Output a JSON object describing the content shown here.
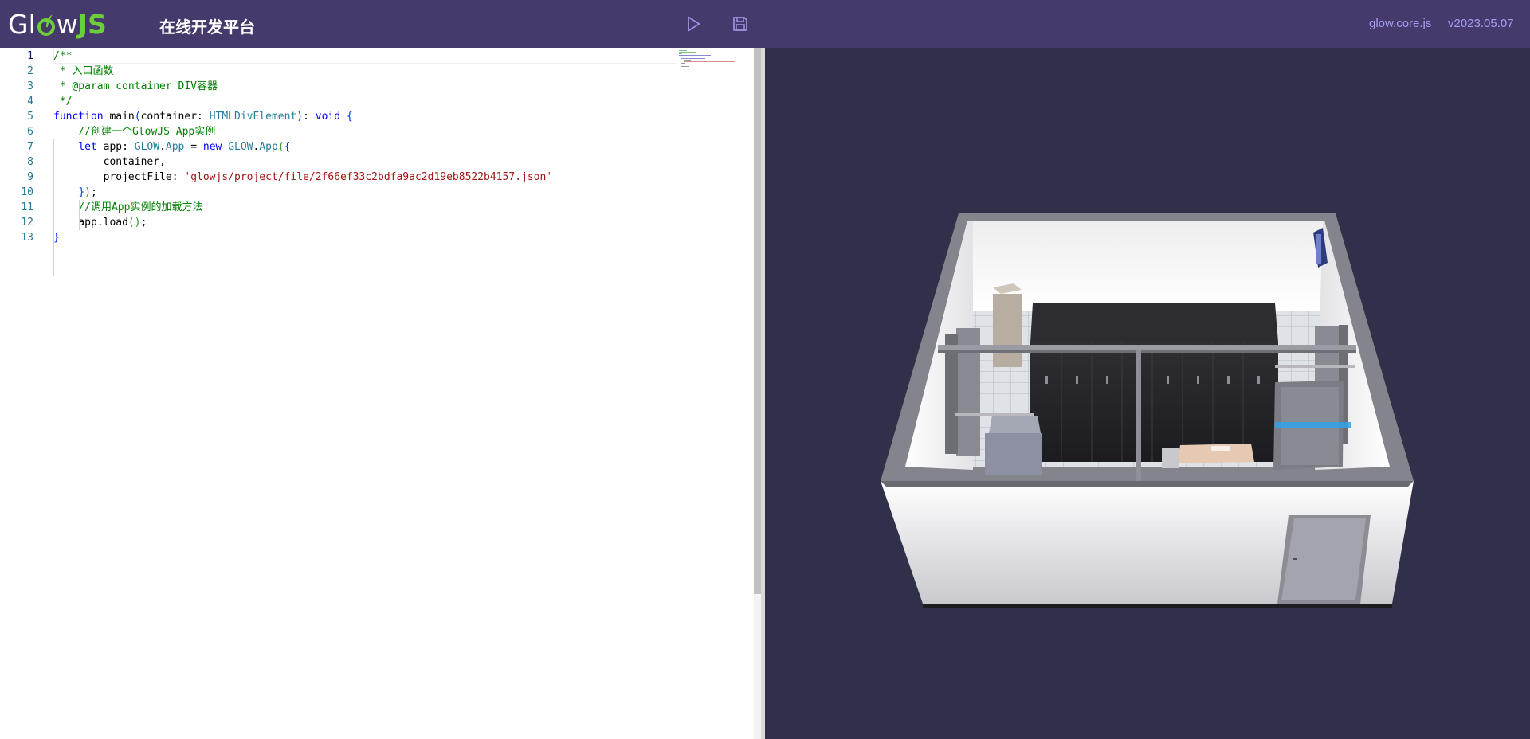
{
  "header": {
    "logo_prefix": "Gl",
    "logo_suffix": "JS",
    "title": "在线开发平台",
    "run_icon": "play-icon",
    "save_icon": "save-icon",
    "lib_name": "glow.core.js",
    "lib_version": "v2023.05.07"
  },
  "editor": {
    "line_numbers": [
      "1",
      "2",
      "3",
      "4",
      "5",
      "6",
      "7",
      "8",
      "9",
      "10",
      "11",
      "12",
      "13"
    ],
    "active_line": 1,
    "lines": [
      [
        {
          "t": "/**",
          "c": "c"
        }
      ],
      [
        {
          "t": " * 入口函数",
          "c": "c"
        }
      ],
      [
        {
          "t": " * @param container DIV容器",
          "c": "c"
        }
      ],
      [
        {
          "t": " */",
          "c": "c"
        }
      ],
      [
        {
          "t": "function",
          "c": "k"
        },
        {
          "t": " main",
          "c": ""
        },
        {
          "t": "(",
          "c": "b"
        },
        {
          "t": "container: ",
          "c": ""
        },
        {
          "t": "HTMLDivElement",
          "c": "t"
        },
        {
          "t": ")",
          "c": "b"
        },
        {
          "t": ": ",
          "c": ""
        },
        {
          "t": "void",
          "c": "k"
        },
        {
          "t": " {",
          "c": "b"
        }
      ],
      [
        {
          "t": "    //创建一个GlowJS App实例",
          "c": "c"
        }
      ],
      [
        {
          "t": "    ",
          "c": ""
        },
        {
          "t": "let",
          "c": "k"
        },
        {
          "t": " app: ",
          "c": ""
        },
        {
          "t": "GLOW",
          "c": "t"
        },
        {
          "t": ".",
          "c": ""
        },
        {
          "t": "App",
          "c": "t"
        },
        {
          "t": " = ",
          "c": ""
        },
        {
          "t": "new",
          "c": "k"
        },
        {
          "t": " ",
          "c": ""
        },
        {
          "t": "GLOW",
          "c": "t"
        },
        {
          "t": ".",
          "c": ""
        },
        {
          "t": "App",
          "c": "t"
        },
        {
          "t": "(",
          "c": "p"
        },
        {
          "t": "{",
          "c": "b"
        }
      ],
      [
        {
          "t": "        container,",
          "c": ""
        }
      ],
      [
        {
          "t": "        projectFile: ",
          "c": ""
        },
        {
          "t": "'glowjs/project/file/2f66ef33c2bdfa9ac2d19eb8522b4157.json'",
          "c": "s"
        }
      ],
      [
        {
          "t": "    ",
          "c": ""
        },
        {
          "t": "}",
          "c": "b"
        },
        {
          "t": ")",
          "c": "p"
        },
        {
          "t": ";",
          "c": ""
        }
      ],
      [
        {
          "t": "    //调用App实例的加载方法",
          "c": "c"
        }
      ],
      [
        {
          "t": "    app.load",
          "c": ""
        },
        {
          "t": "()",
          "c": "p"
        },
        {
          "t": ";",
          "c": ""
        }
      ],
      [
        {
          "t": "}",
          "c": "b"
        }
      ]
    ]
  },
  "colors": {
    "header_bg": "#463a6d",
    "viewport_bg": "#31304a",
    "logo_accent": "#6ccf3a",
    "link": "#a69cf2"
  }
}
